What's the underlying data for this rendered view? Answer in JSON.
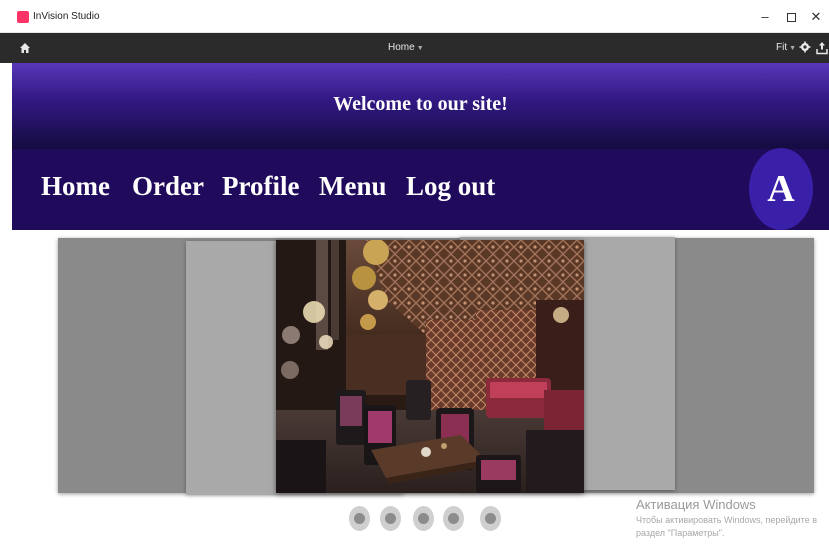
{
  "window": {
    "app_title": "InVision Studio",
    "controls": {
      "minimize": "–",
      "close": "✕"
    }
  },
  "toolbar": {
    "screen_name": "Home",
    "zoom": "Fit"
  },
  "prototype": {
    "welcome_text": "Welcome to our site!",
    "nav": {
      "home": "Home",
      "order": "Order",
      "profile": "Profile",
      "menu": "Menu",
      "logout": "Log out"
    },
    "avatar_letter": "A",
    "carousel": {
      "slide_count": 5,
      "active_slide": 1
    }
  },
  "watermark": {
    "title": "Активация Windows",
    "line1": "Чтобы активировать Windows, перейдите в",
    "line2": "раздел \"Параметры\"."
  },
  "colors": {
    "accent_invision": "#ff3366",
    "banner_top": "#5a37b8",
    "navbar": "#1f0a5c",
    "avatar": "#3a1fa8"
  }
}
